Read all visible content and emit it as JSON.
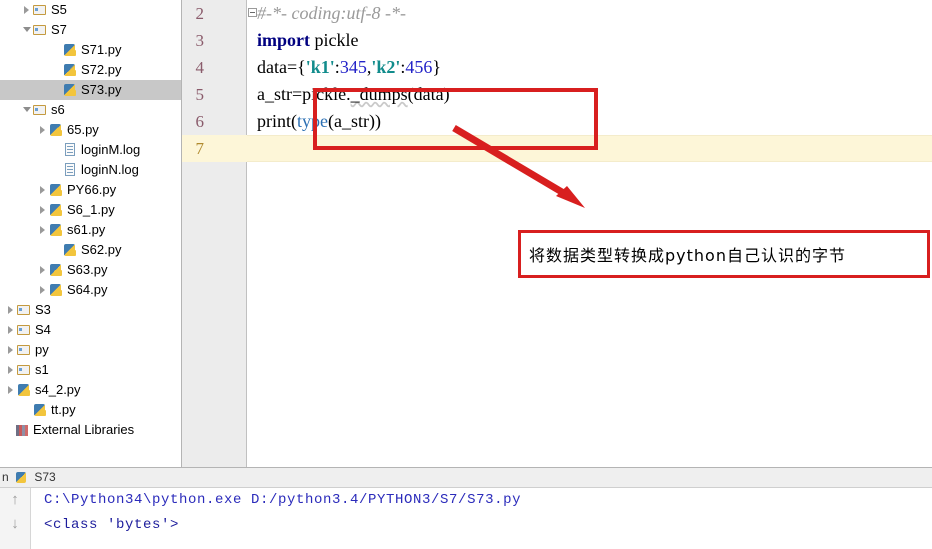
{
  "sidebar": {
    "name": "project-tree",
    "items": [
      {
        "label": "S5",
        "icon": "folder-icon",
        "twisty": "closed",
        "indent": 22,
        "selected": false
      },
      {
        "label": "S7",
        "icon": "folder-icon",
        "twisty": "open",
        "indent": 22,
        "selected": false
      },
      {
        "label": "S71.py",
        "icon": "python-file-icon",
        "twisty": "none",
        "indent": 52,
        "selected": false
      },
      {
        "label": "S72.py",
        "icon": "python-file-icon",
        "twisty": "none",
        "indent": 52,
        "selected": false
      },
      {
        "label": "S73.py",
        "icon": "python-file-icon",
        "twisty": "none",
        "indent": 52,
        "selected": true
      },
      {
        "label": "s6",
        "icon": "folder-icon",
        "twisty": "open",
        "indent": 22,
        "selected": false
      },
      {
        "label": "65.py",
        "icon": "python-file-icon",
        "twisty": "closed",
        "indent": 38,
        "selected": false
      },
      {
        "label": "loginM.log",
        "icon": "log-file-icon",
        "twisty": "none",
        "indent": 52,
        "selected": false
      },
      {
        "label": "loginN.log",
        "icon": "log-file-icon",
        "twisty": "none",
        "indent": 52,
        "selected": false
      },
      {
        "label": "PY66.py",
        "icon": "python-file-icon",
        "twisty": "closed",
        "indent": 38,
        "selected": false
      },
      {
        "label": "S6_1.py",
        "icon": "python-file-icon",
        "twisty": "closed",
        "indent": 38,
        "selected": false
      },
      {
        "label": "s61.py",
        "icon": "python-file-icon",
        "twisty": "closed",
        "indent": 38,
        "selected": false
      },
      {
        "label": "S62.py",
        "icon": "python-file-icon",
        "twisty": "none",
        "indent": 52,
        "selected": false
      },
      {
        "label": "S63.py",
        "icon": "python-file-icon",
        "twisty": "closed",
        "indent": 38,
        "selected": false
      },
      {
        "label": "S64.py",
        "icon": "python-file-icon",
        "twisty": "closed",
        "indent": 38,
        "selected": false
      },
      {
        "label": "S3",
        "icon": "folder-icon",
        "twisty": "closed",
        "indent": 6,
        "selected": false
      },
      {
        "label": "S4",
        "icon": "folder-icon",
        "twisty": "closed",
        "indent": 6,
        "selected": false
      },
      {
        "label": "py",
        "icon": "folder-icon",
        "twisty": "closed",
        "indent": 6,
        "selected": false
      },
      {
        "label": "s1",
        "icon": "folder-icon",
        "twisty": "closed",
        "indent": 6,
        "selected": false
      },
      {
        "label": "s4_2.py",
        "icon": "python-file-icon",
        "twisty": "closed",
        "indent": 6,
        "selected": false
      },
      {
        "label": "tt.py",
        "icon": "python-file-icon",
        "twisty": "none",
        "indent": 22,
        "selected": false
      },
      {
        "label": "External Libraries",
        "icon": "libraries-icon",
        "twisty": "none",
        "indent": 4,
        "selected": false
      }
    ]
  },
  "editor": {
    "name": "code-editor",
    "current_line": 7,
    "gutter_numbers": [
      "2",
      "3",
      "4",
      "5",
      "6",
      "7"
    ],
    "lines": [
      {
        "number": "2",
        "tokens": [
          {
            "t": "#-*- coding:utf-8 -*-",
            "c": "comment"
          }
        ]
      },
      {
        "number": "3",
        "tokens": [
          {
            "t": "import",
            "c": "kw"
          },
          {
            "t": " pickle",
            "c": "plain"
          }
        ]
      },
      {
        "number": "4",
        "tokens": [
          {
            "t": "data=",
            "c": "plain"
          },
          {
            "t": "{",
            "c": "plain"
          },
          {
            "t": "'k1'",
            "c": "str"
          },
          {
            "t": ":",
            "c": "plain"
          },
          {
            "t": "345",
            "c": "num"
          },
          {
            "t": ",",
            "c": "plain"
          },
          {
            "t": "'k2'",
            "c": "str"
          },
          {
            "t": ":",
            "c": "plain"
          },
          {
            "t": "456",
            "c": "num"
          },
          {
            "t": "}",
            "c": "plain"
          }
        ]
      },
      {
        "number": "5",
        "tokens": [
          {
            "t": "a_str=",
            "c": "plain"
          },
          {
            "t": "pickle",
            "c": "plain"
          },
          {
            "t": ".",
            "c": "plain"
          },
          {
            "t": "_dumps",
            "c": "squig"
          },
          {
            "t": "(data)",
            "c": "plain"
          }
        ]
      },
      {
        "number": "6",
        "tokens": [
          {
            "t": "print",
            "c": "plain"
          },
          {
            "t": "(",
            "c": "plain"
          },
          {
            "t": "type",
            "c": "bi"
          },
          {
            "t": "(a_str))",
            "c": "plain"
          }
        ]
      },
      {
        "number": "7",
        "tokens": []
      }
    ]
  },
  "annotations": {
    "code_box_name": "code-highlight-box",
    "note_text": "将数据类型转换成python自己认识的字节",
    "arrow_name": "red-arrow",
    "accent_color": "#d81f1f"
  },
  "console": {
    "name": "run-console",
    "tab_label": "S73",
    "tab_prefix": "n",
    "scroll_up_glyph": "↑",
    "scroll_down_glyph": "↓",
    "output": [
      "C:\\Python34\\python.exe D:/python3.4/PYTHON3/S7/S73.py",
      "<class 'bytes'>"
    ]
  }
}
